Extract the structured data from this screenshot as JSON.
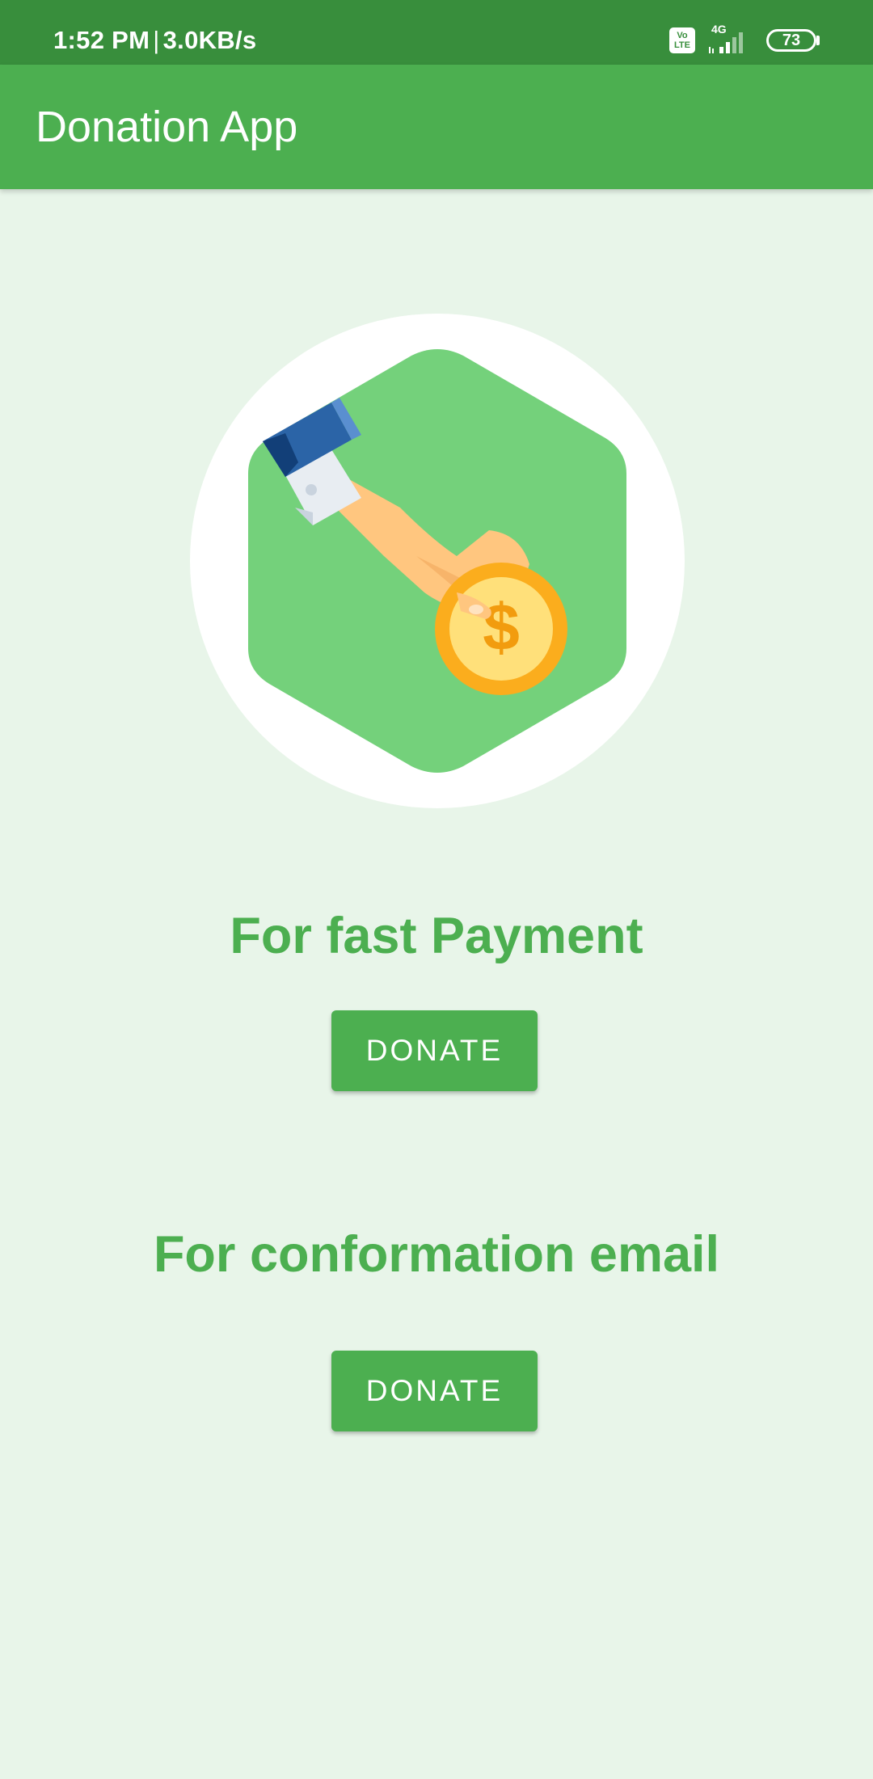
{
  "status_bar": {
    "time": "1:52 PM",
    "separator": "|",
    "network_speed": "3.0KB/s",
    "volte_label": "Vo LTE",
    "network_type": "4G",
    "battery_level": "73"
  },
  "app_bar": {
    "title": "Donation App"
  },
  "hero": {
    "icon": "hand-giving-coin-icon"
  },
  "sections": [
    {
      "heading": "For fast Payment",
      "button_label": "DONATE"
    },
    {
      "heading": "For conformation email",
      "button_label": "DONATE"
    }
  ],
  "colors": {
    "status_bar": "#388e3c",
    "primary": "#4caf50",
    "background": "#e8f5e9",
    "hexagon": "#74d17b",
    "coin": "#fbc02d"
  }
}
